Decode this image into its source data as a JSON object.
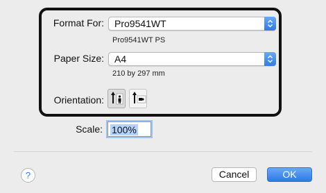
{
  "format_for": {
    "label": "Format For:",
    "value": "Pro9541WT",
    "subtext": "Pro9541WT PS"
  },
  "paper_size": {
    "label": "Paper Size:",
    "value": "A4",
    "subtext": "210 by 297 mm"
  },
  "orientation": {
    "label": "Orientation:",
    "options": [
      "portrait",
      "landscape"
    ],
    "selected": "portrait"
  },
  "scale": {
    "label": "Scale:",
    "value": "100%"
  },
  "footer": {
    "help_label": "?",
    "cancel_label": "Cancel",
    "ok_label": "OK"
  },
  "colors": {
    "accent": "#2f7ae5",
    "highlight_border": "#111111",
    "background": "#ececec"
  }
}
